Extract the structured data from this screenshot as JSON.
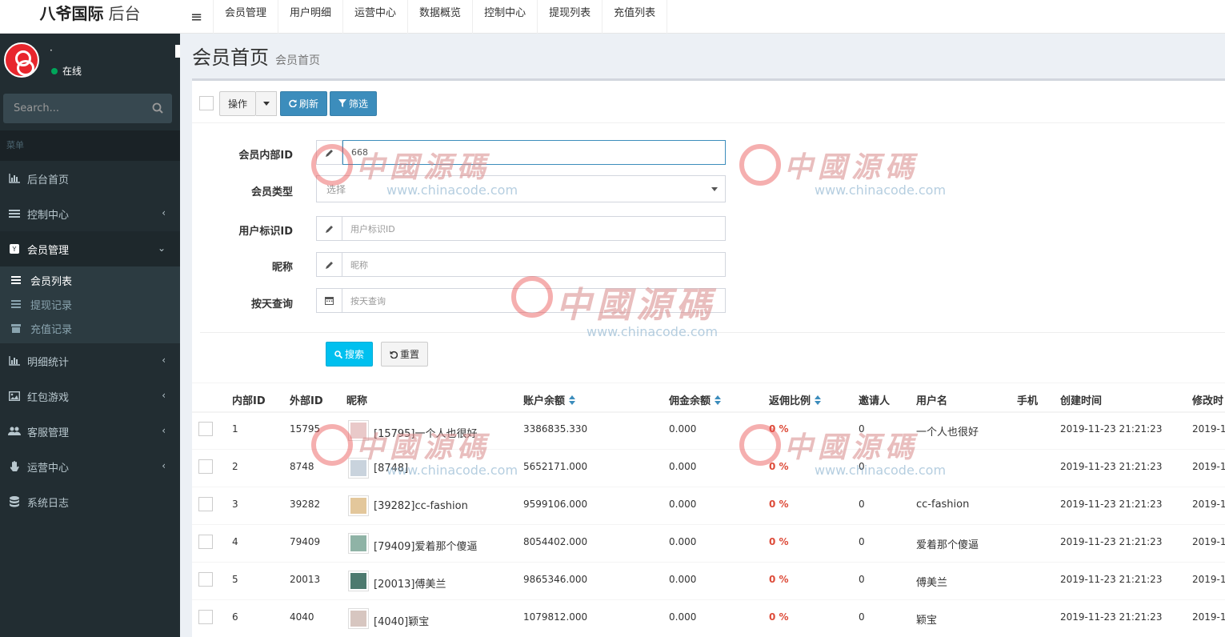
{
  "brand": {
    "bold": "八爷国际",
    "light": "后台"
  },
  "topnav": {
    "toggle": "≡",
    "items": [
      "会员管理",
      "用户明细",
      "运营中心",
      "数据概览",
      "控制中心",
      "提现列表",
      "充值列表"
    ]
  },
  "sidebar": {
    "user_name": "·",
    "user_status": "在线",
    "search_placeholder": "Search...",
    "menu_header": "菜单",
    "items": [
      {
        "label": "后台首页",
        "icon": "bar-chart-icon"
      },
      {
        "label": "控制中心",
        "icon": "list-icon"
      },
      {
        "label": "会员管理",
        "icon": "member-icon"
      },
      {
        "label": "明细统计",
        "icon": "bar-chart-icon"
      },
      {
        "label": "红包游戏",
        "icon": "image-icon"
      },
      {
        "label": "客服管理",
        "icon": "users-icon"
      },
      {
        "label": "运营中心",
        "icon": "hand-icon"
      },
      {
        "label": "系统日志",
        "icon": "database-icon"
      }
    ],
    "submenu": [
      {
        "label": "会员列表"
      },
      {
        "label": "提现记录"
      },
      {
        "label": "充值记录"
      }
    ]
  },
  "header": {
    "title": "会员首页",
    "subtitle": "会员首页"
  },
  "toolbar": {
    "action": "操作",
    "refresh": "刷新",
    "filter": "筛选"
  },
  "form": {
    "member_id": {
      "label": "会员内部ID",
      "value": "668"
    },
    "member_type": {
      "label": "会员类型",
      "placeholder": "选择"
    },
    "user_tag_id": {
      "label": "用户标识ID",
      "placeholder": "用户标识ID"
    },
    "nickname": {
      "label": "昵称",
      "placeholder": "昵称"
    },
    "by_day": {
      "label": "按天查询",
      "placeholder": "按天查询"
    },
    "search": "搜索",
    "reset": "重置"
  },
  "table": {
    "headers": {
      "inner_id": "内部ID",
      "outer_id": "外部ID",
      "nickname": "昵称",
      "balance": "账户余额",
      "commission": "佣金余额",
      "rebate": "返佣比例",
      "inviter": "邀请人",
      "username": "用户名",
      "phone": "手机",
      "created": "创建时间",
      "modified": "修改时"
    },
    "rows": [
      {
        "inner_id": "1",
        "outer_id": "15795",
        "nickname": "[15795]一个人也很好",
        "balance": "3386835.330",
        "commission": "0.000",
        "rebate": "0 %",
        "inviter": "0",
        "username": "一个人也很好",
        "phone": "",
        "created": "2019-11-23 21:21:23",
        "modified": "2019-1",
        "thumb": "#e9c9c9"
      },
      {
        "inner_id": "2",
        "outer_id": "8748",
        "nickname": "[8748]",
        "balance": "5652171.000",
        "commission": "0.000",
        "rebate": "0 %",
        "inviter": "0",
        "username": "",
        "phone": "",
        "created": "2019-11-23 21:21:23",
        "modified": "2019-1",
        "thumb": "#c9d3dd"
      },
      {
        "inner_id": "3",
        "outer_id": "39282",
        "nickname": "[39282]cc-fashion",
        "balance": "9599106.000",
        "commission": "0.000",
        "rebate": "0 %",
        "inviter": "0",
        "username": "cc-fashion",
        "phone": "",
        "created": "2019-11-23 21:21:23",
        "modified": "2019-1",
        "thumb": "#e3c79b"
      },
      {
        "inner_id": "4",
        "outer_id": "79409",
        "nickname": "[79409]爱着那个傻逼",
        "balance": "8054402.000",
        "commission": "0.000",
        "rebate": "0 %",
        "inviter": "0",
        "username": "爱着那个傻逼",
        "phone": "",
        "created": "2019-11-23 21:21:23",
        "modified": "2019-1",
        "thumb": "#8fb3a6"
      },
      {
        "inner_id": "5",
        "outer_id": "20013",
        "nickname": "[20013]傅美兰",
        "balance": "9865346.000",
        "commission": "0.000",
        "rebate": "0 %",
        "inviter": "0",
        "username": "傅美兰",
        "phone": "",
        "created": "2019-11-23 21:21:23",
        "modified": "2019-1",
        "thumb": "#4d7a6f"
      },
      {
        "inner_id": "6",
        "outer_id": "4040",
        "nickname": "[4040]颖宝",
        "balance": "1079812.000",
        "commission": "0.000",
        "rebate": "0 %",
        "inviter": "0",
        "username": "颖宝",
        "phone": "",
        "created": "2019-11-23 21:21:23",
        "modified": "2019-1",
        "thumb": "#d7c6c0"
      }
    ]
  },
  "watermark": {
    "cn": "中國源碼",
    "url": "www.chinacode.com"
  },
  "colors": {
    "sidebar": "#222d32",
    "primary": "#3c8dbc",
    "info": "#00c0ef",
    "danger": "#dd4b39"
  }
}
